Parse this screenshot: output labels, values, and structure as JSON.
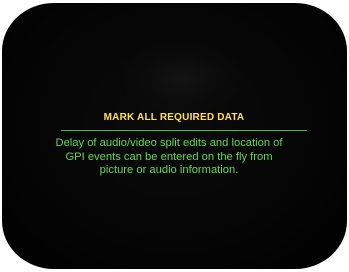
{
  "screen": {
    "title": "MARK ALL REQUIRED DATA",
    "description": "Delay of audio/video split edits and location of GPI events can be entered on the fly from picture or audio information.",
    "colors": {
      "title": "#ffe14a",
      "body": "#63d94f",
      "rule": "#3fbf3f",
      "background": "#000000"
    }
  }
}
